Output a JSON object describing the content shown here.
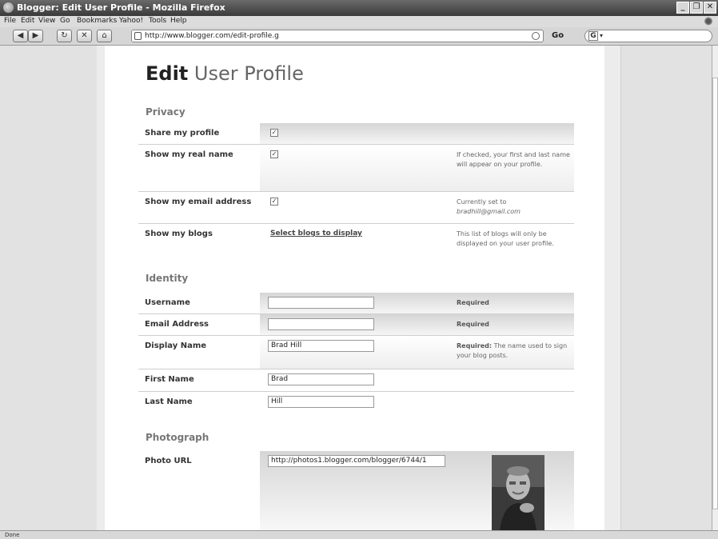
{
  "window": {
    "title": "Blogger: Edit User Profile - Mozilla Firefox"
  },
  "menu": [
    "File",
    "Edit",
    "View",
    "Go",
    "Bookmarks",
    "Yahoo!",
    "Tools",
    "Help"
  ],
  "toolbar": {
    "url": "http://www.blogger.com/edit-profile.g",
    "go_label": "Go"
  },
  "status": "Done",
  "page": {
    "title_bold": "Edit",
    "title_rest": " User Profile",
    "privacy": {
      "heading": "Privacy",
      "share_label": "Share my profile",
      "realname_label": "Show my real name",
      "realname_hint": "If checked, your first and last name will appear on your profile.",
      "email_label": "Show my email address",
      "email_hint_prefix": "Currently set to",
      "email_hint_value": "bradhill@gmail.com",
      "blogs_label": "Show my blogs",
      "blogs_link": "Select blogs to display",
      "blogs_hint": "This list of blogs will only be displayed on your user profile."
    },
    "identity": {
      "heading": "Identity",
      "username_label": "Username",
      "username_value": "",
      "username_hint": "Required",
      "email_label": "Email Address",
      "email_value": "",
      "email_hint": "Required",
      "display_label": "Display Name",
      "display_value": "Brad Hill",
      "display_hint_bold": "Required:",
      "display_hint": " The name used to sign your blog posts.",
      "first_label": "First Name",
      "first_value": "Brad",
      "last_label": "Last Name",
      "last_value": "Hill"
    },
    "photograph": {
      "heading": "Photograph",
      "url_label": "Photo URL",
      "url_value": "http://photos1.blogger.com/blogger/6744/1"
    }
  }
}
